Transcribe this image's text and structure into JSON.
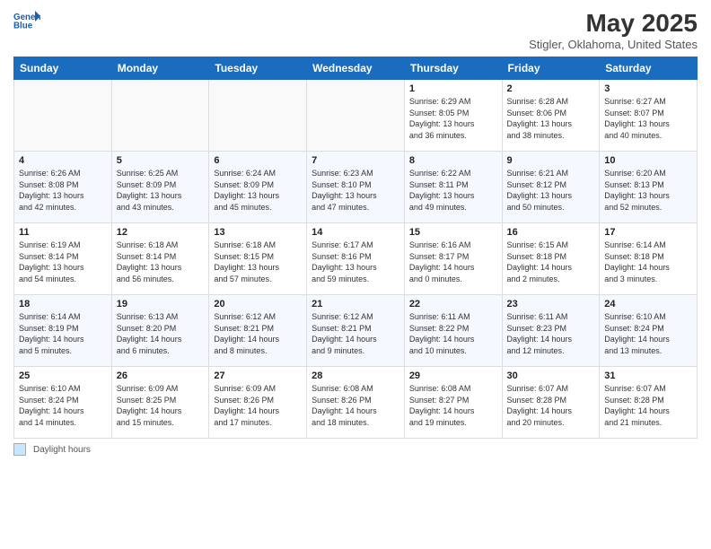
{
  "header": {
    "logo_line1": "General",
    "logo_line2": "Blue",
    "title": "May 2025",
    "subtitle": "Stigler, Oklahoma, United States"
  },
  "calendar": {
    "days_of_week": [
      "Sunday",
      "Monday",
      "Tuesday",
      "Wednesday",
      "Thursday",
      "Friday",
      "Saturday"
    ],
    "weeks": [
      [
        {
          "day": "",
          "info": ""
        },
        {
          "day": "",
          "info": ""
        },
        {
          "day": "",
          "info": ""
        },
        {
          "day": "",
          "info": ""
        },
        {
          "day": "1",
          "info": "Sunrise: 6:29 AM\nSunset: 8:05 PM\nDaylight: 13 hours\nand 36 minutes."
        },
        {
          "day": "2",
          "info": "Sunrise: 6:28 AM\nSunset: 8:06 PM\nDaylight: 13 hours\nand 38 minutes."
        },
        {
          "day": "3",
          "info": "Sunrise: 6:27 AM\nSunset: 8:07 PM\nDaylight: 13 hours\nand 40 minutes."
        }
      ],
      [
        {
          "day": "4",
          "info": "Sunrise: 6:26 AM\nSunset: 8:08 PM\nDaylight: 13 hours\nand 42 minutes."
        },
        {
          "day": "5",
          "info": "Sunrise: 6:25 AM\nSunset: 8:09 PM\nDaylight: 13 hours\nand 43 minutes."
        },
        {
          "day": "6",
          "info": "Sunrise: 6:24 AM\nSunset: 8:09 PM\nDaylight: 13 hours\nand 45 minutes."
        },
        {
          "day": "7",
          "info": "Sunrise: 6:23 AM\nSunset: 8:10 PM\nDaylight: 13 hours\nand 47 minutes."
        },
        {
          "day": "8",
          "info": "Sunrise: 6:22 AM\nSunset: 8:11 PM\nDaylight: 13 hours\nand 49 minutes."
        },
        {
          "day": "9",
          "info": "Sunrise: 6:21 AM\nSunset: 8:12 PM\nDaylight: 13 hours\nand 50 minutes."
        },
        {
          "day": "10",
          "info": "Sunrise: 6:20 AM\nSunset: 8:13 PM\nDaylight: 13 hours\nand 52 minutes."
        }
      ],
      [
        {
          "day": "11",
          "info": "Sunrise: 6:19 AM\nSunset: 8:14 PM\nDaylight: 13 hours\nand 54 minutes."
        },
        {
          "day": "12",
          "info": "Sunrise: 6:18 AM\nSunset: 8:14 PM\nDaylight: 13 hours\nand 56 minutes."
        },
        {
          "day": "13",
          "info": "Sunrise: 6:18 AM\nSunset: 8:15 PM\nDaylight: 13 hours\nand 57 minutes."
        },
        {
          "day": "14",
          "info": "Sunrise: 6:17 AM\nSunset: 8:16 PM\nDaylight: 13 hours\nand 59 minutes."
        },
        {
          "day": "15",
          "info": "Sunrise: 6:16 AM\nSunset: 8:17 PM\nDaylight: 14 hours\nand 0 minutes."
        },
        {
          "day": "16",
          "info": "Sunrise: 6:15 AM\nSunset: 8:18 PM\nDaylight: 14 hours\nand 2 minutes."
        },
        {
          "day": "17",
          "info": "Sunrise: 6:14 AM\nSunset: 8:18 PM\nDaylight: 14 hours\nand 3 minutes."
        }
      ],
      [
        {
          "day": "18",
          "info": "Sunrise: 6:14 AM\nSunset: 8:19 PM\nDaylight: 14 hours\nand 5 minutes."
        },
        {
          "day": "19",
          "info": "Sunrise: 6:13 AM\nSunset: 8:20 PM\nDaylight: 14 hours\nand 6 minutes."
        },
        {
          "day": "20",
          "info": "Sunrise: 6:12 AM\nSunset: 8:21 PM\nDaylight: 14 hours\nand 8 minutes."
        },
        {
          "day": "21",
          "info": "Sunrise: 6:12 AM\nSunset: 8:21 PM\nDaylight: 14 hours\nand 9 minutes."
        },
        {
          "day": "22",
          "info": "Sunrise: 6:11 AM\nSunset: 8:22 PM\nDaylight: 14 hours\nand 10 minutes."
        },
        {
          "day": "23",
          "info": "Sunrise: 6:11 AM\nSunset: 8:23 PM\nDaylight: 14 hours\nand 12 minutes."
        },
        {
          "day": "24",
          "info": "Sunrise: 6:10 AM\nSunset: 8:24 PM\nDaylight: 14 hours\nand 13 minutes."
        }
      ],
      [
        {
          "day": "25",
          "info": "Sunrise: 6:10 AM\nSunset: 8:24 PM\nDaylight: 14 hours\nand 14 minutes."
        },
        {
          "day": "26",
          "info": "Sunrise: 6:09 AM\nSunset: 8:25 PM\nDaylight: 14 hours\nand 15 minutes."
        },
        {
          "day": "27",
          "info": "Sunrise: 6:09 AM\nSunset: 8:26 PM\nDaylight: 14 hours\nand 17 minutes."
        },
        {
          "day": "28",
          "info": "Sunrise: 6:08 AM\nSunset: 8:26 PM\nDaylight: 14 hours\nand 18 minutes."
        },
        {
          "day": "29",
          "info": "Sunrise: 6:08 AM\nSunset: 8:27 PM\nDaylight: 14 hours\nand 19 minutes."
        },
        {
          "day": "30",
          "info": "Sunrise: 6:07 AM\nSunset: 8:28 PM\nDaylight: 14 hours\nand 20 minutes."
        },
        {
          "day": "31",
          "info": "Sunrise: 6:07 AM\nSunset: 8:28 PM\nDaylight: 14 hours\nand 21 minutes."
        }
      ]
    ]
  },
  "footer": {
    "daylight_label": "Daylight hours"
  }
}
